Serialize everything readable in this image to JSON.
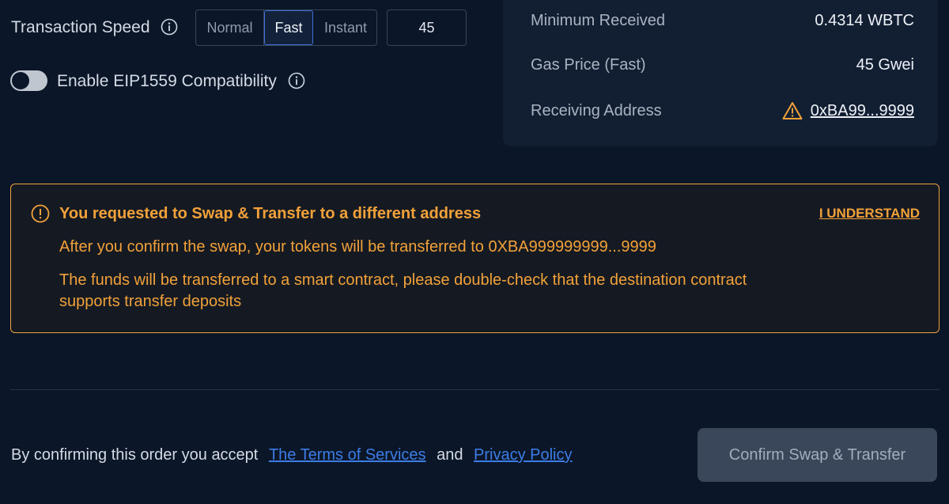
{
  "settings": {
    "speed_label": "Transaction Speed",
    "speed_options": [
      "Normal",
      "Fast",
      "Instant"
    ],
    "selected_speed": "Fast",
    "gas_value": "45",
    "eip_label": "Enable EIP1559 Compatibility",
    "eip_enabled": false
  },
  "summary": {
    "rows": [
      {
        "label": "Minimum Received",
        "value": "0.4314 WBTC"
      },
      {
        "label": "Gas Price (Fast)",
        "value": "45 Gwei"
      },
      {
        "label": "Receiving Address",
        "value": "0xBA99...9999"
      }
    ]
  },
  "warning": {
    "title": "You requested to Swap & Transfer to a different address",
    "action": "I UNDERSTAND",
    "line1": "After you confirm the swap, your tokens will be transferred to 0XBA999999999...9999",
    "line2": "The funds will be transferred to a smart contract, please double-check that the destination contract supports transfer deposits"
  },
  "footer": {
    "consent_prefix": "By confirming this order you accept",
    "terms_link": "The Terms of Services",
    "conjunction": "and",
    "privacy_link": "Privacy Policy",
    "confirm_label": "Confirm Swap & Transfer"
  },
  "colors": {
    "background": "#0b1628",
    "panel": "#121f33",
    "warning": "#f2a13a",
    "link": "#3c7de6",
    "selected_border": "#3e6fd8"
  }
}
